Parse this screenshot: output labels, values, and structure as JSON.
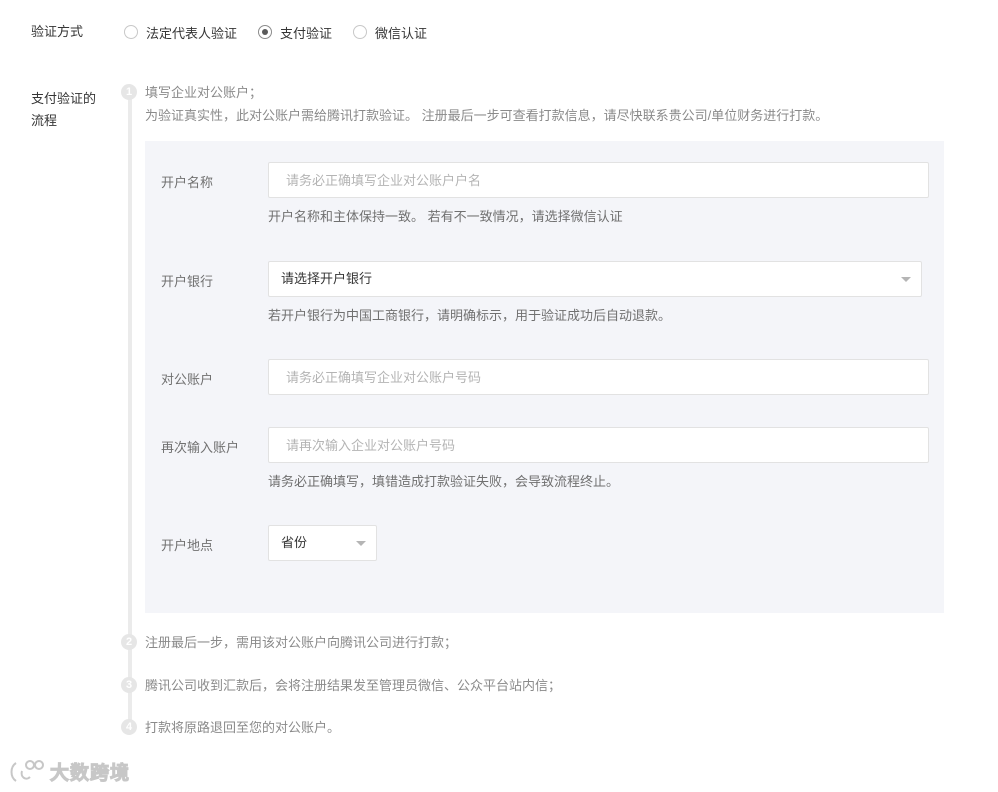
{
  "verify_method": {
    "label": "验证方式",
    "options": [
      {
        "label": "法定代表人验证",
        "checked": false
      },
      {
        "label": "支付验证",
        "checked": true
      },
      {
        "label": "微信认证",
        "checked": false
      }
    ]
  },
  "flow": {
    "label_line1": "支付验证的",
    "label_line2": "流程",
    "steps": [
      {
        "num": "1",
        "title": "填写企业对公账户；",
        "desc": "为验证真实性，此对公账户需给腾讯打款验证。 注册最后一步可查看打款信息，请尽快联系贵公司/单位财务进行打款。"
      },
      {
        "num": "2",
        "title": "注册最后一步，需用该对公账户向腾讯公司进行打款；"
      },
      {
        "num": "3",
        "title": "腾讯公司收到汇款后，会将注册结果发至管理员微信、公众平台站内信；"
      },
      {
        "num": "4",
        "title": "打款将原路退回至您的对公账户。"
      }
    ]
  },
  "form": {
    "account_name": {
      "label": "开户名称",
      "placeholder": "请务必正确填写企业对公账户户名",
      "value": "",
      "tip": "开户名称和主体保持一致。 若有不一致情况，请选择微信认证"
    },
    "bank": {
      "label": "开户银行",
      "selected": "请选择开户银行",
      "tip": "若开户银行为中国工商银行，请明确标示，用于验证成功后自动退款。"
    },
    "account_no": {
      "label": "对公账户",
      "placeholder": "请务必正确填写企业对公账户号码",
      "value": ""
    },
    "account_no_confirm": {
      "label": "再次输入账户",
      "placeholder": "请再次输入企业对公账户号码",
      "value": "",
      "tip": "请务必正确填写，填错造成打款验证失败，会导致流程终止。"
    },
    "location": {
      "label": "开户地点",
      "province": "省份"
    }
  },
  "watermark": {
    "text": "大数跨境"
  }
}
